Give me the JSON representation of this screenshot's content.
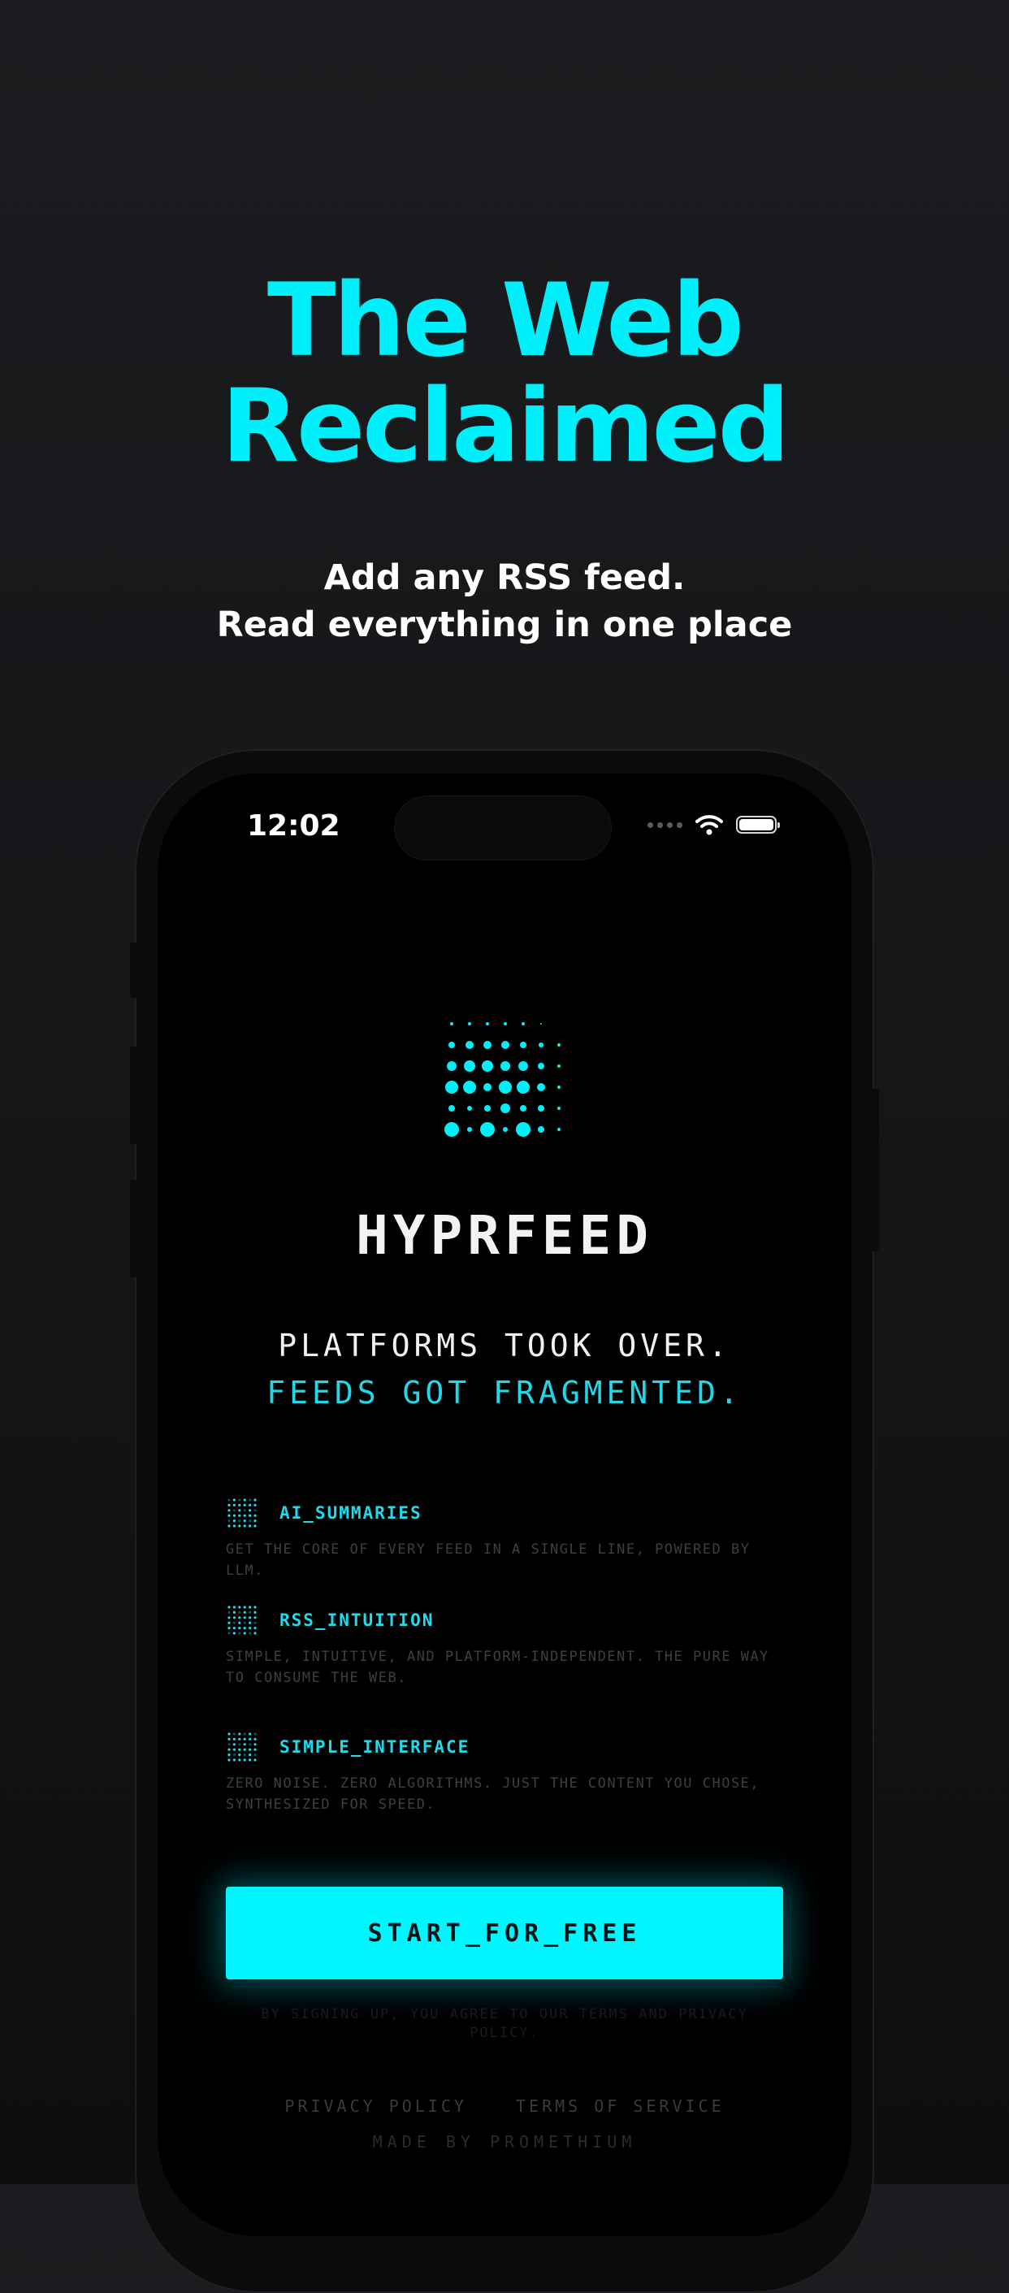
{
  "hero": {
    "title_line1": "The Web",
    "title_line2": "Reclaimed",
    "subtitle_line1": "Add any RSS feed.",
    "subtitle_line2": "Read everything in one place"
  },
  "status_bar": {
    "time": "12:02"
  },
  "app": {
    "brand": "HYPRFEED",
    "tagline_line1": "PLATFORMS TOOK OVER.",
    "tagline_line2": "FEEDS GOT FRAGMENTED.",
    "features": [
      {
        "title": "AI_SUMMARIES",
        "desc": "GET THE CORE OF EVERY FEED IN A SINGLE LINE, POWERED BY LLM."
      },
      {
        "title": "RSS_INTUITION",
        "desc": "SIMPLE, INTUITIVE, AND PLATFORM-INDEPENDENT. THE PURE WAY TO CONSUME THE WEB."
      },
      {
        "title": "SIMPLE_INTERFACE",
        "desc": "ZERO NOISE. ZERO ALGORITHMS. JUST THE CONTENT YOU CHOSE, SYNTHESIZED FOR SPEED."
      }
    ],
    "cta_label": "START_FOR_FREE",
    "terms": "BY SIGNING UP, YOU AGREE TO OUR TERMS AND PRIVACY POLICY.",
    "privacy_link": "PRIVACY POLICY",
    "terms_link": "TERMS OF SERVICE",
    "made_by": "MADE BY PROMETHIUM"
  },
  "colors": {
    "accent": "#00f0fb",
    "background": "#141517",
    "screen": "#000000"
  }
}
